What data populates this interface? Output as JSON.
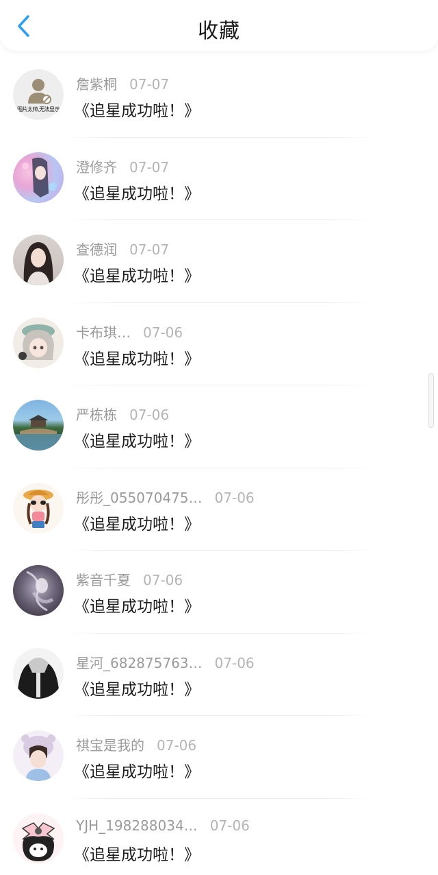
{
  "header": {
    "title": "收藏",
    "back_icon": "chevron-left-icon",
    "accent": "#2a9df4"
  },
  "items": [
    {
      "name": "詹紫桐",
      "date": "07-07",
      "message": "《追星成功啦！》",
      "avatar": "placeholder",
      "avatar_caption": "图片太帅,无法显示"
    },
    {
      "name": "澄修齐",
      "date": "07-07",
      "message": "《追星成功啦！》",
      "avatar": "anime-girl-pink"
    },
    {
      "name": "查德润",
      "date": "07-07",
      "message": "《追星成功啦！》",
      "avatar": "photo-woman"
    },
    {
      "name": "卡布琪…",
      "date": "07-06",
      "message": "《追星成功啦！》",
      "avatar": "anime-girl-hat"
    },
    {
      "name": "严栋栋",
      "date": "07-06",
      "message": "《追星成功啦！》",
      "avatar": "landscape-pavilion"
    },
    {
      "name": "彤彤_055070475…",
      "date": "07-06",
      "message": "《追星成功啦！》",
      "avatar": "cartoon-girl-sunhat"
    },
    {
      "name": "紫音千夏",
      "date": "07-06",
      "message": "《追星成功啦！》",
      "avatar": "dark-anime-dragon"
    },
    {
      "name": "星河_682875763…",
      "date": "07-06",
      "message": "《追星成功啦！》",
      "avatar": "black-jacket"
    },
    {
      "name": "祺宝是我的",
      "date": "07-06",
      "message": "《追星成功啦！》",
      "avatar": "boy-bear-hood"
    },
    {
      "name": "YJH_198288034…",
      "date": "07-06",
      "message": "《追星成功啦！》",
      "avatar": "kuromi-bow"
    }
  ]
}
